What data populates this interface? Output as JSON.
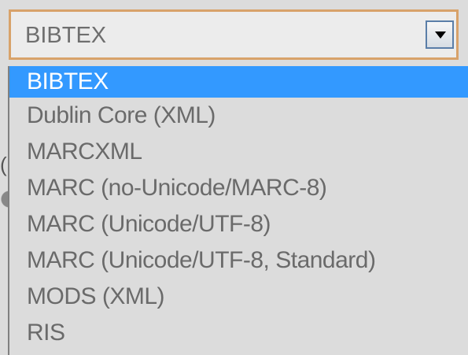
{
  "select": {
    "value": "BIBTEX",
    "arrow_icon": "dropdown-arrow-icon"
  },
  "background": {
    "fragment_char": "("
  },
  "dropdown": {
    "selected_color": "#3399ff",
    "options": [
      {
        "label": "BIBTEX",
        "selected": true
      },
      {
        "label": "Dublin Core (XML)",
        "selected": false
      },
      {
        "label": "MARCXML",
        "selected": false
      },
      {
        "label": "MARC (no-Unicode/MARC-8)",
        "selected": false
      },
      {
        "label": "MARC (Unicode/UTF-8)",
        "selected": false
      },
      {
        "label": "MARC (Unicode/UTF-8, Standard)",
        "selected": false
      },
      {
        "label": "MODS (XML)",
        "selected": false
      },
      {
        "label": "RIS",
        "selected": false
      }
    ]
  }
}
